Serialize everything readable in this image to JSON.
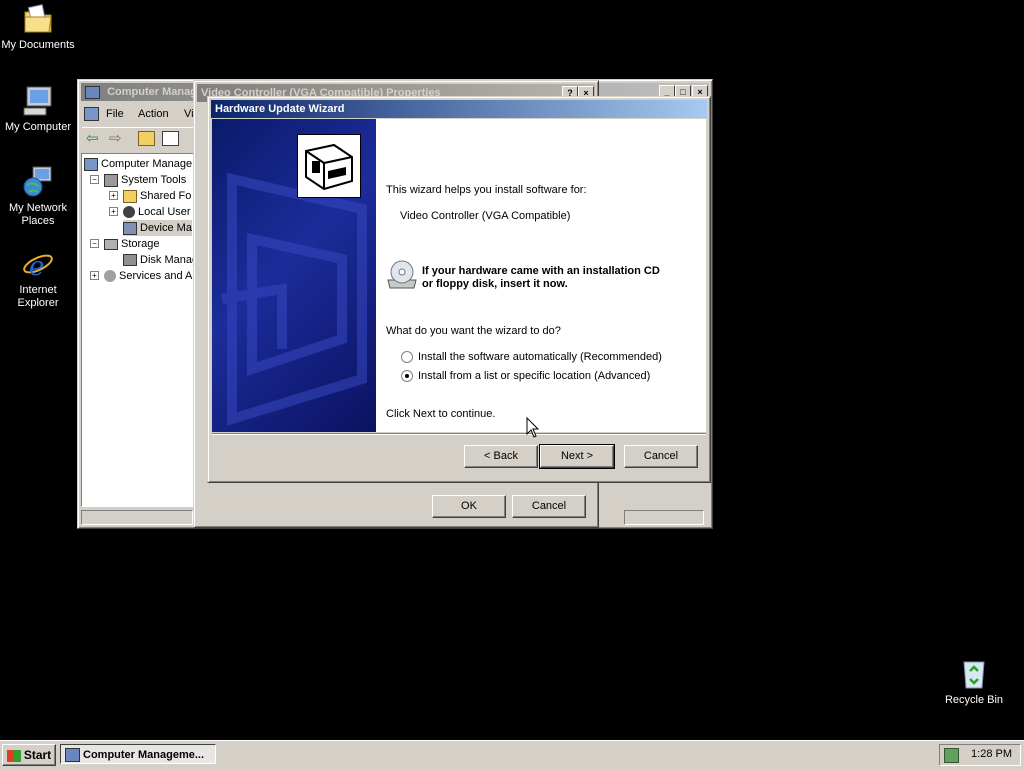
{
  "desktop": {
    "icons": [
      {
        "label_line1": "My Documents",
        "label_line2": ""
      },
      {
        "label_line1": "My Computer",
        "label_line2": ""
      },
      {
        "label_line1": "My Network",
        "label_line2": "Places"
      },
      {
        "label_line1": "Internet",
        "label_line2": "Explorer"
      },
      {
        "label_line1": "Recycle Bin",
        "label_line2": ""
      }
    ]
  },
  "computer_management": {
    "title": "Computer Manag",
    "menu": {
      "file": "File",
      "action": "Action",
      "view": "Vi"
    },
    "tree": [
      {
        "label": "Computer Manage"
      },
      {
        "label": "System Tools"
      },
      {
        "label": "Shared Fo"
      },
      {
        "label": "Local User"
      },
      {
        "label": "Device Ma"
      },
      {
        "label": "Storage"
      },
      {
        "label": "Disk Manag"
      },
      {
        "label": "Services and A"
      }
    ]
  },
  "properties_dialog": {
    "title": "Video Controller (VGA Compatible) Properties",
    "help_button": "?",
    "close_button": "×",
    "ok_label": "OK",
    "cancel_label": "Cancel"
  },
  "wizard": {
    "title": "Hardware Update Wizard",
    "intro": "This wizard helps you install software for:",
    "device_name": "Video Controller (VGA Compatible)",
    "cd_hint_line1": "If your hardware came with an installation CD",
    "cd_hint_line2": "or floppy disk, insert it now.",
    "question": "What do you want the wizard to do?",
    "options": [
      {
        "label": "Install the software automatically (Recommended)",
        "checked": false
      },
      {
        "label": "Install from a list or specific location (Advanced)",
        "checked": true
      }
    ],
    "continue_text": "Click Next to continue.",
    "back_label": "< Back",
    "next_label": "Next >",
    "cancel_label": "Cancel"
  },
  "taskbar": {
    "start_label": "Start",
    "task_button_label": "Computer Manageme...",
    "clock": "1:28 PM"
  }
}
